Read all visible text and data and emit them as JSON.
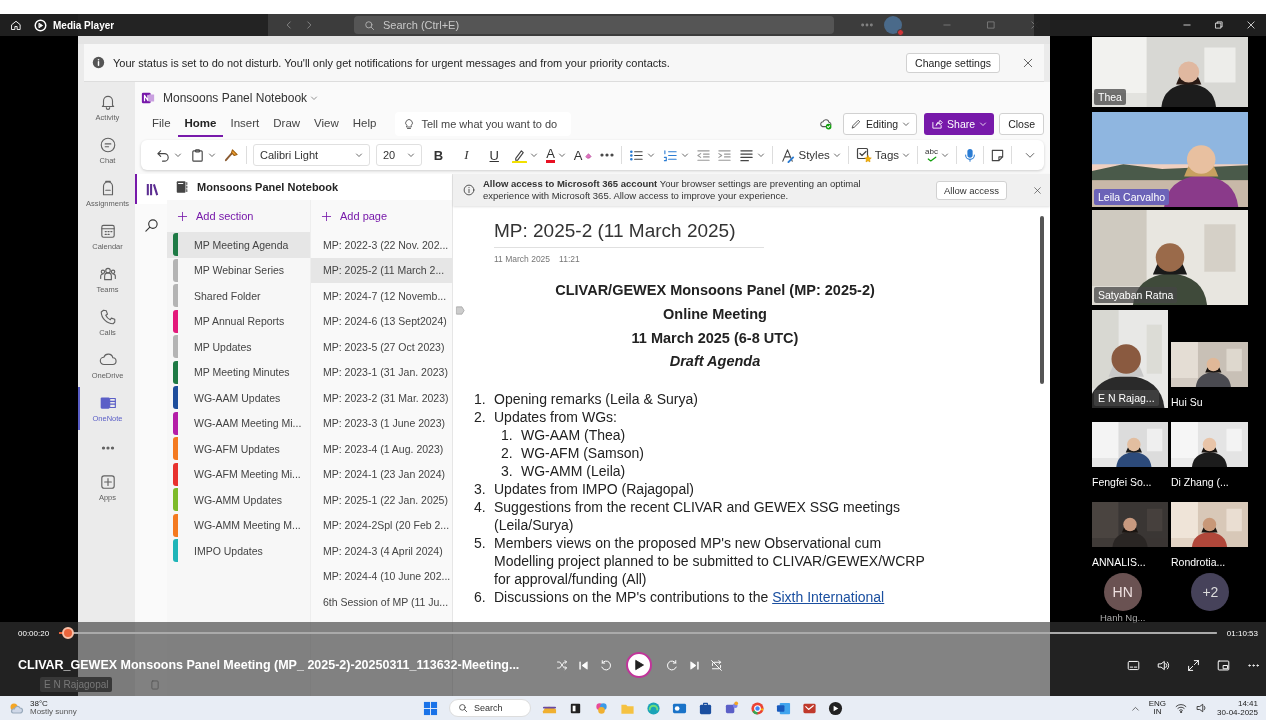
{
  "player": {
    "app_title": "Media Player",
    "elapsed": "00:00:20",
    "duration": "01:10:53",
    "level": 0.008,
    "video_title": "CLIVAR_GEWEX Monsoons Panel Meeting (MP_ 2025-2)-20250311_113632-Meeting..."
  },
  "teams": {
    "search_placeholder": "Search (Ctrl+E)",
    "notice": {
      "text": "Your status is set to do not disturb. You'll only get notifications for urgent messages and from your priority contacts.",
      "button": "Change settings"
    },
    "rail": [
      {
        "kind": "app",
        "label": "Activity",
        "selected": false
      },
      {
        "kind": "app",
        "label": "Chat",
        "selected": false
      },
      {
        "kind": "app",
        "label": "Assignments",
        "selected": false
      },
      {
        "kind": "app",
        "label": "Calendar",
        "selected": false
      },
      {
        "kind": "app",
        "label": "Teams",
        "selected": false
      },
      {
        "kind": "app",
        "label": "Calls",
        "selected": false
      },
      {
        "kind": "app",
        "label": "OneDrive",
        "selected": false
      },
      {
        "kind": "app",
        "label": "OneNote",
        "selected": true
      },
      {
        "kind": "more",
        "selected": false
      },
      {
        "kind": "app",
        "label": "Apps",
        "selected": false
      }
    ],
    "presenter_label": "E N Rajagopal"
  },
  "onenote": {
    "notebook": "Monsoons Panel Notebook",
    "tabs": [
      {
        "label": "File",
        "selected": false
      },
      {
        "label": "Home",
        "selected": true
      },
      {
        "label": "Insert",
        "selected": false
      },
      {
        "label": "Draw",
        "selected": false
      },
      {
        "label": "View",
        "selected": false
      },
      {
        "label": "Help",
        "selected": false
      }
    ],
    "tell_me": "Tell me what you want to do",
    "editing": "Editing",
    "share": "Share",
    "close": "Close",
    "ribbon": {
      "font": "Calibri Light",
      "size": "20",
      "bold": "B",
      "italic": "I",
      "underline": "U",
      "font_color": "A",
      "clear_format": "A",
      "styles": "Styles",
      "tags": "Tags",
      "spelling": "abc"
    },
    "nav_title": "Monsoons Panel Notebook",
    "add_section": "Add section",
    "add_page": "Add page",
    "sections": [
      {
        "name": "MP Meeting Agenda",
        "color": "#1e7a45",
        "selected": true
      },
      {
        "name": "MP Webinar Series",
        "color": "#b4b4b4",
        "selected": false
      },
      {
        "name": "Shared Folder",
        "color": "#b4b4b4",
        "selected": false
      },
      {
        "name": "MP Annual Reports",
        "color": "#e3197b",
        "selected": false
      },
      {
        "name": "MP Updates",
        "color": "#b4b4b4",
        "selected": false
      },
      {
        "name": "MP Meeting Minutes",
        "color": "#1e7a45",
        "selected": false
      },
      {
        "name": "WG-AAM Updates",
        "color": "#1e4e9c",
        "selected": false
      },
      {
        "name": "WG-AAM Meeting Mi...",
        "color": "#b51ea8",
        "selected": false
      },
      {
        "name": "WG-AFM Updates",
        "color": "#f47a20",
        "selected": false
      },
      {
        "name": "WG-AFM Meeting Mi...",
        "color": "#e8322e",
        "selected": false
      },
      {
        "name": "WG-AMM Updates",
        "color": "#7dbb2a",
        "selected": false
      },
      {
        "name": "WG-AMM Meeting M...",
        "color": "#f47a20",
        "selected": false
      },
      {
        "name": "IMPO Updates",
        "color": "#1fb5b8",
        "selected": false
      }
    ],
    "pages": [
      {
        "title": "MP: 2022-3 (22 Nov. 202...",
        "selected": false
      },
      {
        "title": "MP: 2025-2 (11 March 2...",
        "selected": true
      },
      {
        "title": "MP: 2024-7 (12 Novemb...",
        "selected": false
      },
      {
        "title": "MP: 2024-6 (13 Sept2024)",
        "selected": false
      },
      {
        "title": "MP: 2023-5 (27 Oct 2023)",
        "selected": false
      },
      {
        "title": "MP: 2023-1 (31 Jan. 2023)",
        "selected": false
      },
      {
        "title": "MP: 2023-2 (31 Mar. 2023)",
        "selected": false
      },
      {
        "title": "MP: 2023-3 (1 June 2023)",
        "selected": false
      },
      {
        "title": "MP: 2023-4 (1 Aug. 2023)",
        "selected": false
      },
      {
        "title": "MP: 2024-1 (23 Jan 2024)",
        "selected": false
      },
      {
        "title": "MP: 2025-1 (22 Jan. 2025)",
        "selected": false
      },
      {
        "title": "MP: 2024-2Spl (20 Feb 2...",
        "selected": false
      },
      {
        "title": "MP: 2024-3 (4 April 2024)",
        "selected": false
      },
      {
        "title": "MP: 2024-4 (10 June 202...",
        "selected": false
      },
      {
        "title": "6th Session of MP (11 Ju...",
        "selected": false
      }
    ],
    "banner": {
      "text": "**Allow access to Microsoft 365 account** Your browser settings are preventing an optimal experience with Microsoft 365. Allow access to improve your experience.",
      "button": "Allow access"
    },
    "page": {
      "title": "MP: 2025-2 (11 March 2025)",
      "date": "11 March 2025",
      "time": "11:21",
      "headings": [
        {
          "text": "CLIVAR/GEWEX Monsoons Panel (MP: 2025-2)",
          "kind": "bold"
        },
        {
          "text": "Online Meeting",
          "kind": "bold"
        },
        {
          "text": "11 March 2025 (6-8 UTC)",
          "kind": "bold"
        },
        {
          "text": "Draft Agenda",
          "kind": "bold-italic"
        }
      ],
      "agenda": [
        {
          "number": "1.",
          "text": "Opening remarks (Leila & Surya)"
        },
        {
          "number": "2.",
          "text": "Updates from WGs:",
          "children": [
            {
              "number": "1.",
              "text": "WG-AAM (Thea)"
            },
            {
              "number": "2.",
              "text": "WG-AFM (Samson)"
            },
            {
              "number": "3.",
              "text": "WG-AMM (Leila)"
            }
          ]
        },
        {
          "number": "3.",
          "text": "Updates from IMPO (Rajagopal)"
        },
        {
          "number": "4.",
          "text": "Suggestions from the recent CLIVAR and GEWEX SSG meetings (Leila/Surya)"
        },
        {
          "number": "5.",
          "text": "Members views on the proposed MP's new Observational cum Modelling project planned to be submitted to CLIVAR/GEWEX/WCRP for approval/funding (All)"
        },
        {
          "number": "6.",
          "text": "Discussions on the MP's contributions to the",
          "link": "Sixth International"
        }
      ]
    }
  },
  "participants": [
    {
      "name": "Thea",
      "kind": "wide",
      "highlighted": false
    },
    {
      "name": "Leila Carvalho",
      "kind": "wide",
      "highlighted": true
    },
    {
      "name": "Satyaban Ratna",
      "kind": "wide",
      "highlighted": false
    },
    {
      "name": "E N Rajag...",
      "kind": "tall",
      "highlighted": false
    },
    {
      "name": "Hui Su",
      "kind": "small",
      "highlighted": false
    },
    {
      "name": "Fengfei So...",
      "kind": "small",
      "highlighted": false
    },
    {
      "name": "Di Zhang (...",
      "kind": "small",
      "highlighted": false
    },
    {
      "name": "ANNALIS...",
      "kind": "small",
      "highlighted": false
    },
    {
      "name": "Rondrotia...",
      "kind": "small",
      "highlighted": false
    }
  ],
  "overflow": {
    "initials": "HN",
    "name": "Hanh Ng...",
    "more": "+2"
  },
  "taskbar": {
    "temperature": "38°C",
    "weather": "Mostly sunny",
    "search": "Search",
    "language": "ENG",
    "region": "IN",
    "time": "14:41",
    "date": "30-04-2025"
  }
}
